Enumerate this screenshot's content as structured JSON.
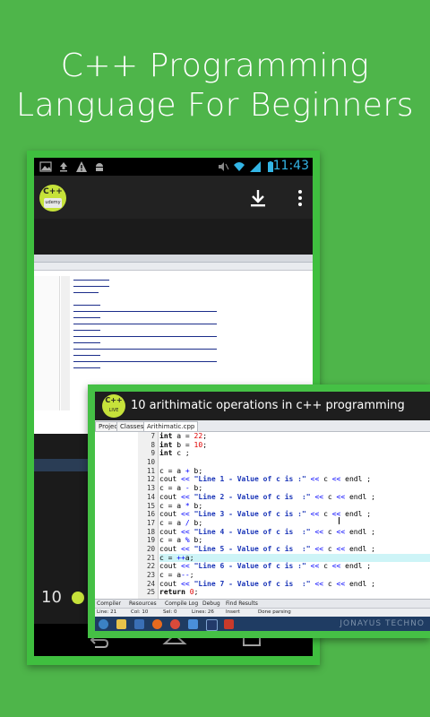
{
  "headline": {
    "line1": "C++ Programming",
    "line2": "Language For Beginners"
  },
  "status_bar": {
    "time": "11:43",
    "icons": [
      "image-icon",
      "upload-icon",
      "warning-icon",
      "android-icon",
      "mute-icon",
      "wifi-icon",
      "signal-icon",
      "battery-icon"
    ]
  },
  "app_bar": {
    "logo_text": "C++",
    "logo_sub": "udemy",
    "actions": [
      "download-icon",
      "overflow-menu-icon"
    ]
  },
  "player": {
    "counter": "10"
  },
  "popup": {
    "title": "10  arithimatic operations in c++ programming",
    "logo_text": "C++",
    "logo_sub": "LIVE",
    "tabs": [
      "Project",
      "Classes"
    ],
    "file_tab": "Arithimatic.cpp",
    "line_numbers": [
      "7",
      "8",
      "9",
      "10",
      "11",
      "12",
      "13",
      "14",
      "15",
      "16",
      "17",
      "18",
      "19",
      "20",
      "21",
      "22",
      "23",
      "24",
      "25"
    ],
    "highlight_line": "21",
    "bottom_tabs": [
      "Compiler",
      "Resources",
      "Compile Log",
      "Debug",
      "Find Results"
    ],
    "status": {
      "line": "Line: 21",
      "col": "Col: 10",
      "sel": "Sel: 0",
      "lines": "Lines: 26",
      "mode": "Insert",
      "msg": "Done parsing"
    },
    "watermark": "JONAYUS TECHNO"
  },
  "colors": {
    "background": "#4eb54a",
    "frame": "#3fbf3f",
    "accent": "#c6e23a",
    "status_blue": "#33b5e5"
  }
}
